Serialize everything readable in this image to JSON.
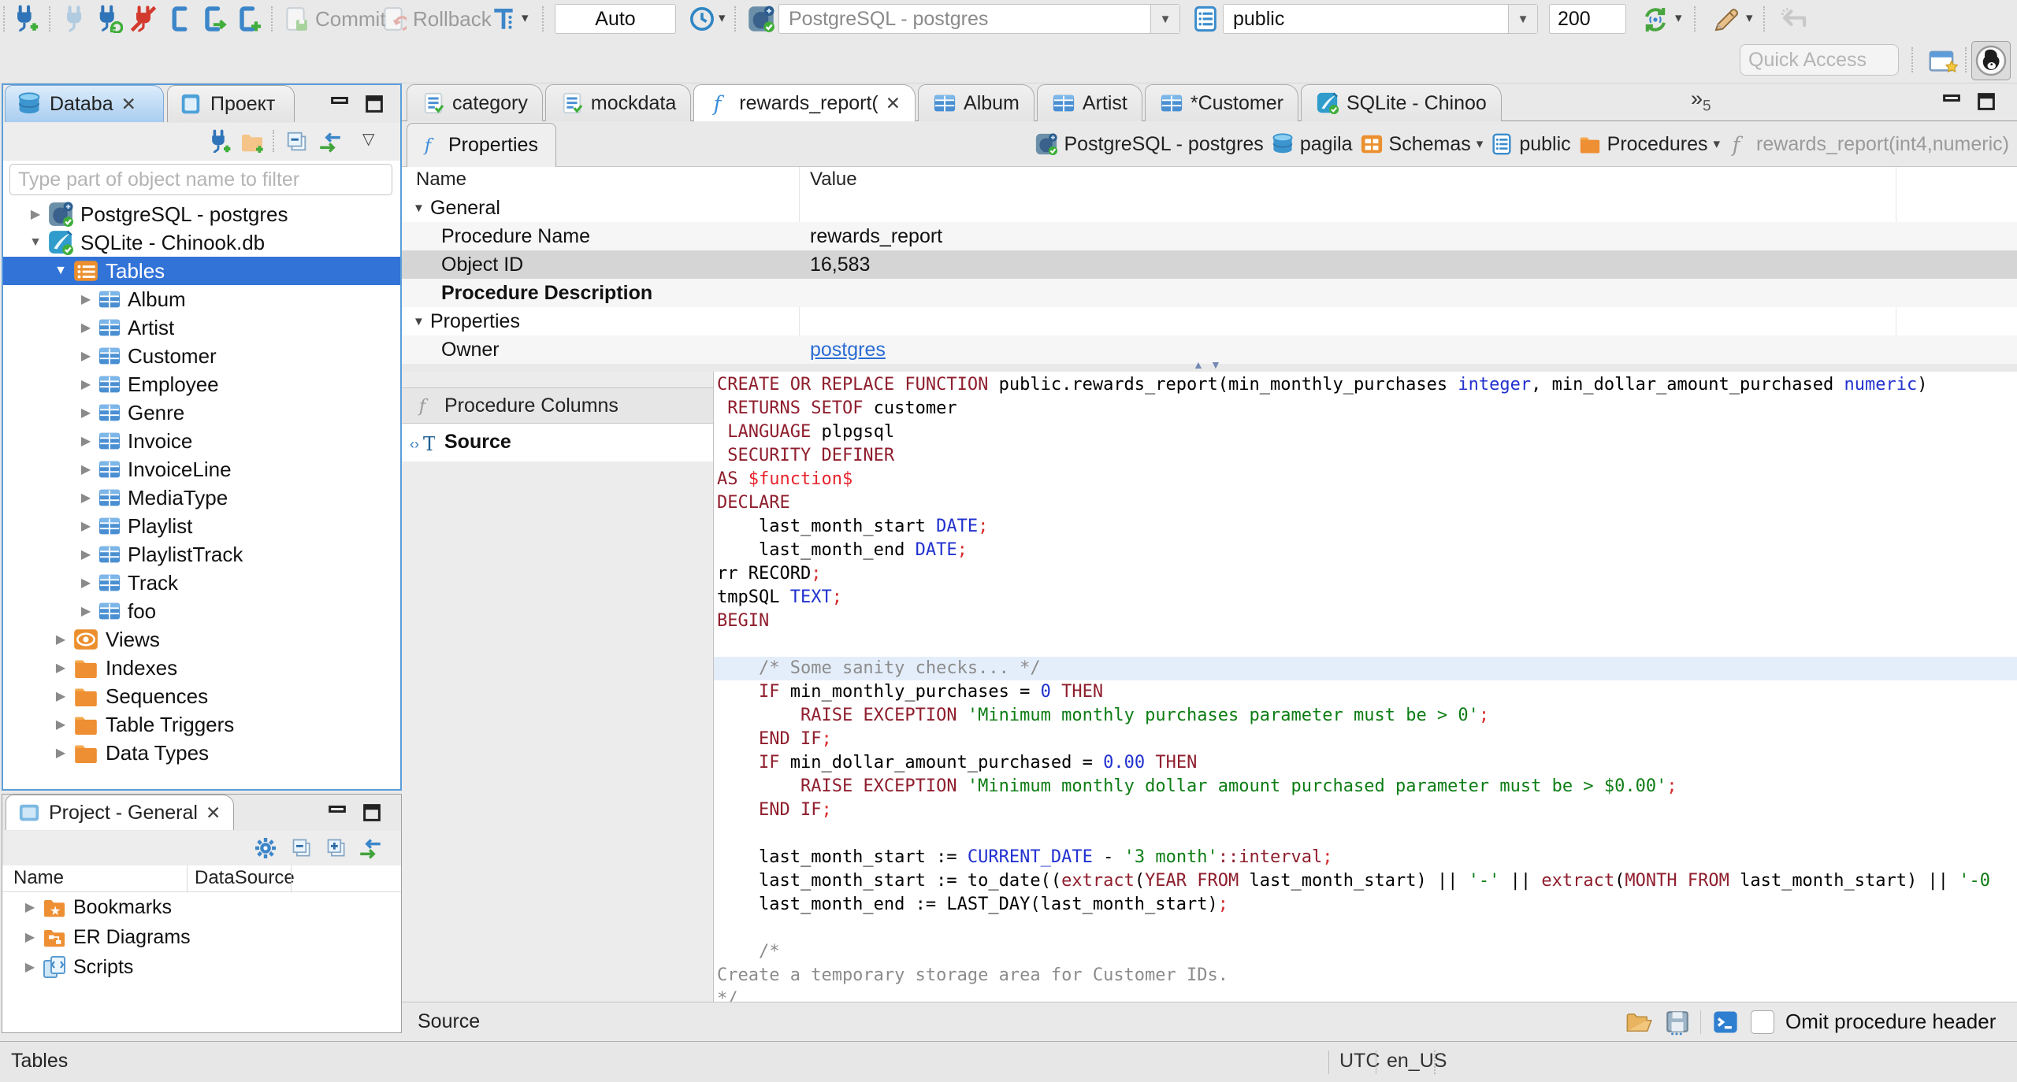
{
  "colors": {
    "selection": "#3273d8",
    "link": "#2a6cd4",
    "keyword": "#8f1e2d",
    "type": "#2131cf",
    "string": "#0d7d14",
    "comment": "#8c8c8c",
    "dollar": "#e8252d",
    "semicolon": "#d72c2c",
    "line_highlight": "#e4eefb"
  },
  "toolbar": {
    "commit_label": "Commit",
    "rollback_label": "Rollback",
    "auto_label": "Auto",
    "connection_combo": "PostgreSQL - postgres",
    "schema_combo": "public",
    "fetch_size": "200"
  },
  "quick_access": {
    "placeholder": "Quick Access"
  },
  "navigator": {
    "tabs": {
      "database": "Databa",
      "project": "Проект"
    },
    "filter_placeholder": "Type part of object name to filter",
    "tree": [
      {
        "label": "PostgreSQL - postgres",
        "icon": "postgres",
        "exp": "closed",
        "lvl": 0
      },
      {
        "label": "SQLite - Chinook.db",
        "icon": "sqlite",
        "exp": "open",
        "lvl": 0
      },
      {
        "label": "Tables",
        "icon": "tables",
        "exp": "open",
        "lvl": 1,
        "sel": true
      },
      {
        "label": "Album",
        "icon": "table",
        "exp": "closed",
        "lvl": 2
      },
      {
        "label": "Artist",
        "icon": "table",
        "exp": "closed",
        "lvl": 2
      },
      {
        "label": "Customer",
        "icon": "table",
        "exp": "closed",
        "lvl": 2
      },
      {
        "label": "Employee",
        "icon": "table",
        "exp": "closed",
        "lvl": 2
      },
      {
        "label": "Genre",
        "icon": "table",
        "exp": "closed",
        "lvl": 2
      },
      {
        "label": "Invoice",
        "icon": "table",
        "exp": "closed",
        "lvl": 2
      },
      {
        "label": "InvoiceLine",
        "icon": "table",
        "exp": "closed",
        "lvl": 2
      },
      {
        "label": "MediaType",
        "icon": "table",
        "exp": "closed",
        "lvl": 2
      },
      {
        "label": "Playlist",
        "icon": "table",
        "exp": "closed",
        "lvl": 2
      },
      {
        "label": "PlaylistTrack",
        "icon": "table",
        "exp": "closed",
        "lvl": 2
      },
      {
        "label": "Track",
        "icon": "table",
        "exp": "closed",
        "lvl": 2
      },
      {
        "label": "foo",
        "icon": "table",
        "exp": "closed",
        "lvl": 2
      },
      {
        "label": "Views",
        "icon": "views",
        "exp": "closed",
        "lvl": 1
      },
      {
        "label": "Indexes",
        "icon": "folder",
        "exp": "closed",
        "lvl": 1
      },
      {
        "label": "Sequences",
        "icon": "folder",
        "exp": "closed",
        "lvl": 1
      },
      {
        "label": "Table Triggers",
        "icon": "folder",
        "exp": "closed",
        "lvl": 1
      },
      {
        "label": "Data Types",
        "icon": "folder",
        "exp": "closed",
        "lvl": 1
      }
    ]
  },
  "project_panel": {
    "title": "Project - General",
    "columns": [
      "Name",
      "DataSource"
    ],
    "items": [
      {
        "label": "Bookmarks",
        "icon": "bookmarks"
      },
      {
        "label": "ER Diagrams",
        "icon": "er"
      },
      {
        "label": "Scripts",
        "icon": "scripts"
      }
    ]
  },
  "editor_tabs": [
    {
      "label": "category",
      "icon": "sql"
    },
    {
      "label": "mockdata",
      "icon": "sql"
    },
    {
      "label": "rewards_report(",
      "icon": "func",
      "active": true,
      "close": true
    },
    {
      "label": "Album",
      "icon": "table"
    },
    {
      "label": "Artist",
      "icon": "table"
    },
    {
      "label": "*Customer",
      "icon": "table"
    },
    {
      "label": "SQLite - Chinoo",
      "icon": "sqlite"
    }
  ],
  "editor_tabs_overflow": "5",
  "properties_view": {
    "tab_label": "Properties",
    "breadcrumbs": [
      {
        "label": "PostgreSQL - postgres",
        "icon": "postgres"
      },
      {
        "label": "pagila",
        "icon": "db"
      },
      {
        "label": "Schemas",
        "icon": "schemas",
        "caret": true
      },
      {
        "label": "public",
        "icon": "page"
      },
      {
        "label": "Procedures",
        "icon": "folder",
        "caret": true
      },
      {
        "label": "rewards_report(int4,numeric)",
        "icon": "funcgray",
        "muted": true
      }
    ],
    "columns": [
      "Name",
      "Value"
    ],
    "rows": [
      {
        "name": "General",
        "group": true
      },
      {
        "name": "Procedure Name",
        "value": "rewards_report"
      },
      {
        "name": "Object ID",
        "value": "16,583",
        "selected": true
      },
      {
        "name": "Procedure Description",
        "bold": true
      },
      {
        "name": "Properties",
        "group": true
      },
      {
        "name": "Owner",
        "value": "postgres",
        "link": true
      }
    ]
  },
  "subtabs": [
    {
      "label": "Procedure Columns",
      "icon": "funcgray"
    },
    {
      "label": "Source",
      "icon": "source",
      "active": true
    }
  ],
  "source_footer": {
    "label": "Source",
    "omit_label": "Omit procedure header"
  },
  "status_bar": {
    "left": "Tables",
    "timezone": "UTC",
    "locale": "en_US"
  },
  "code": {
    "lines": [
      {
        "seg": [
          [
            "k",
            "CREATE OR REPLACE FUNCTION"
          ],
          [
            "p",
            " public.rewards_report(min_monthly_purchases "
          ],
          [
            "t",
            "integer"
          ],
          [
            "p",
            ", min_dollar_amount_purchased "
          ],
          [
            "t",
            "numeric"
          ],
          [
            "p",
            ")"
          ]
        ]
      },
      {
        "seg": [
          [
            "p",
            " "
          ],
          [
            "k",
            "RETURNS SETOF"
          ],
          [
            "p",
            " customer"
          ]
        ]
      },
      {
        "seg": [
          [
            "p",
            " "
          ],
          [
            "k",
            "LANGUAGE"
          ],
          [
            "p",
            " plpgsql"
          ]
        ]
      },
      {
        "seg": [
          [
            "p",
            " "
          ],
          [
            "k",
            "SECURITY DEFINER"
          ]
        ]
      },
      {
        "seg": [
          [
            "k",
            "AS"
          ],
          [
            "p",
            " "
          ],
          [
            "d",
            "$function$"
          ]
        ]
      },
      {
        "seg": [
          [
            "k",
            "DECLARE"
          ]
        ]
      },
      {
        "seg": [
          [
            "p",
            "    last_month_start "
          ],
          [
            "t",
            "DATE"
          ],
          [
            "x",
            ";"
          ]
        ]
      },
      {
        "seg": [
          [
            "p",
            "    last_month_end "
          ],
          [
            "t",
            "DATE"
          ],
          [
            "x",
            ";"
          ]
        ]
      },
      {
        "seg": [
          [
            "p",
            "rr RECORD"
          ],
          [
            "x",
            ";"
          ]
        ]
      },
      {
        "seg": [
          [
            "p",
            "tmpSQL "
          ],
          [
            "t",
            "TEXT"
          ],
          [
            "x",
            ";"
          ]
        ]
      },
      {
        "seg": [
          [
            "k",
            "BEGIN"
          ]
        ]
      },
      {
        "seg": []
      },
      {
        "hl": true,
        "seg": [
          [
            "p",
            "    "
          ],
          [
            "c",
            "/* Some sanity checks... */"
          ]
        ]
      },
      {
        "seg": [
          [
            "p",
            "    "
          ],
          [
            "k",
            "IF"
          ],
          [
            "p",
            " min_monthly_purchases = "
          ],
          [
            "t",
            "0"
          ],
          [
            "p",
            " "
          ],
          [
            "k",
            "THEN"
          ]
        ]
      },
      {
        "seg": [
          [
            "p",
            "        "
          ],
          [
            "k",
            "RAISE EXCEPTION"
          ],
          [
            "p",
            " "
          ],
          [
            "s",
            "'Minimum monthly purchases parameter must be > 0'"
          ],
          [
            "x",
            ";"
          ]
        ]
      },
      {
        "seg": [
          [
            "p",
            "    "
          ],
          [
            "k",
            "END IF"
          ],
          [
            "x",
            ";"
          ]
        ]
      },
      {
        "seg": [
          [
            "p",
            "    "
          ],
          [
            "k",
            "IF"
          ],
          [
            "p",
            " min_dollar_amount_purchased = "
          ],
          [
            "t",
            "0.00"
          ],
          [
            "p",
            " "
          ],
          [
            "k",
            "THEN"
          ]
        ]
      },
      {
        "seg": [
          [
            "p",
            "        "
          ],
          [
            "k",
            "RAISE EXCEPTION"
          ],
          [
            "p",
            " "
          ],
          [
            "s",
            "'Minimum monthly dollar amount purchased parameter must be > $0.00'"
          ],
          [
            "x",
            ";"
          ]
        ]
      },
      {
        "seg": [
          [
            "p",
            "    "
          ],
          [
            "k",
            "END IF"
          ],
          [
            "x",
            ";"
          ]
        ]
      },
      {
        "seg": []
      },
      {
        "seg": [
          [
            "p",
            "    last_month_start := "
          ],
          [
            "t",
            "CURRENT_DATE"
          ],
          [
            "p",
            " - "
          ],
          [
            "s",
            "'3 month'"
          ],
          [
            "k",
            "::interval"
          ],
          [
            "x",
            ";"
          ]
        ]
      },
      {
        "seg": [
          [
            "p",
            "    last_month_start := to_date(("
          ],
          [
            "k",
            "extract"
          ],
          [
            "p",
            "("
          ],
          [
            "k",
            "YEAR FROM"
          ],
          [
            "p",
            " last_month_start) || "
          ],
          [
            "s",
            "'-'"
          ],
          [
            "p",
            " || "
          ],
          [
            "k",
            "extract"
          ],
          [
            "p",
            "("
          ],
          [
            "k",
            "MONTH FROM"
          ],
          [
            "p",
            " last_month_start) || "
          ],
          [
            "s",
            "'-0"
          ]
        ]
      },
      {
        "seg": [
          [
            "p",
            "    last_month_end := LAST_DAY(last_month_start)"
          ],
          [
            "x",
            ";"
          ]
        ]
      },
      {
        "seg": []
      },
      {
        "seg": [
          [
            "p",
            "    "
          ],
          [
            "c",
            "/*"
          ]
        ]
      },
      {
        "seg": [
          [
            "c",
            "Create a temporary storage area for Customer IDs."
          ]
        ]
      },
      {
        "seg": [
          [
            "c",
            "*/"
          ]
        ]
      }
    ]
  }
}
